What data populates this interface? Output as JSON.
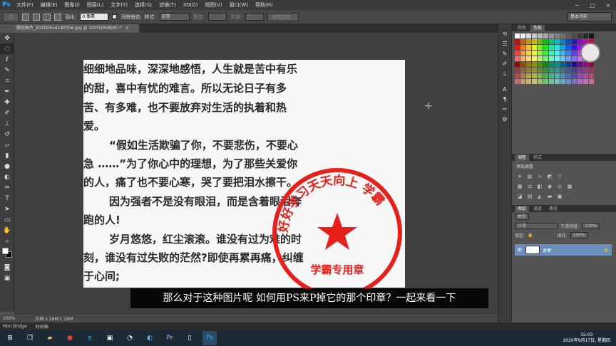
{
  "app": {
    "logo": "Ps",
    "menu": [
      "文件(F)",
      "编辑(E)",
      "图像(I)",
      "图层(L)",
      "文字(Y)",
      "选择(S)",
      "滤镜(T)",
      "3D(D)",
      "视图(V)",
      "窗口(W)",
      "帮助(H)"
    ],
    "window_controls": [
      "−",
      "□",
      "×"
    ]
  },
  "options_bar": {
    "feather_label": "羽化:",
    "feather_value": "0 像素",
    "antialias_label": "消除锯齿",
    "style_label": "样式:",
    "style_value": "正常",
    "width_label": "宽度:",
    "height_label": "高度:",
    "refine_edge_button": "调整边缘...",
    "workspace": "基本功能"
  },
  "document_tab": {
    "title": "微信图片_20200916180356.jpg @ 100%(RGB/8) *",
    "close": "×"
  },
  "document_lines": [
    "细细地品味，深深地感悟，人生就是苦中有乐",
    "的甜，喜中有忧的难言。所以无论日子有多",
    "苦、有多难，也不要放弃对生活的执着和热",
    "爱。",
    "“假如生活欺骗了你，不要悲伤，不要心",
    "急 ……”为了你心中的理想，为了那些关爱你",
    "的人，痛了也不要心寒，哭了要把泪水擦干。",
    "因为强者不是没有眼泪，而是含着眼泪奔",
    "跑的人!",
    "岁月悠悠，红尘滚滚。谁没有过为难的时",
    "刻，谁没有过失败的茫然?即使再累再痛，纠缠",
    "于心间;"
  ],
  "stamp": {
    "arc_text": "好好学习天天向上 学霸",
    "bottom_text": "学霸专用章",
    "color": "#e8201c"
  },
  "subtitle": "那么对于这种图片呢 如何用PS来P掉它的那个印章？一起来看一下",
  "status_bar": {
    "zoom": "100%",
    "doc_size": "文档:1.28M/1.28M"
  },
  "bottom_panel": {
    "mini_bridge": "Mini Bridge",
    "timeline": "时间轴"
  },
  "color_panel": {
    "tabs": [
      "颜色",
      "色板"
    ]
  },
  "adjustments_panel": {
    "tabs": [
      "调整",
      "样式"
    ],
    "title": "添加调整"
  },
  "layers_panel": {
    "tabs": [
      "图层",
      "通道",
      "路径"
    ],
    "kind_label": "类型",
    "blend_mode": "正常",
    "opacity_label": "不透明度:",
    "opacity_value": "100%",
    "lock_label": "锁定:",
    "fill_label": "填充:",
    "fill_value": "100%",
    "layer_name": "背景"
  },
  "taskbar": {
    "time": "15:03",
    "date": "2020年9月17日, 星期四"
  }
}
